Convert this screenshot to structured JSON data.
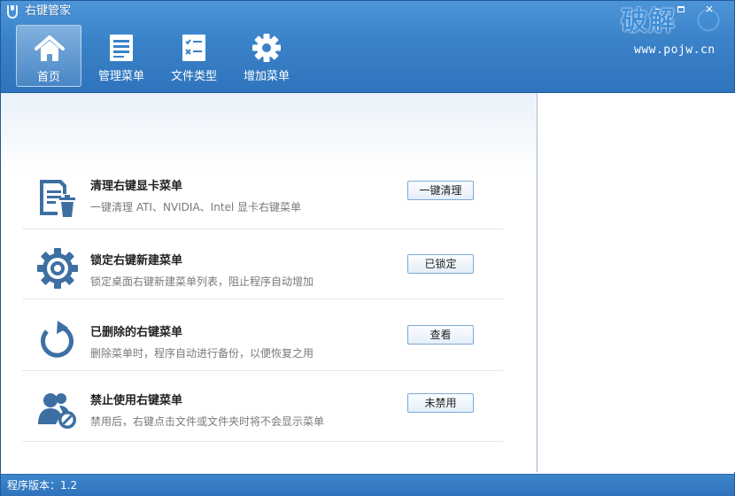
{
  "window": {
    "title": "右键管家",
    "minimize": "–",
    "close": "×"
  },
  "watermark": {
    "main": "破解",
    "url": "www.pojw.cn"
  },
  "nav": {
    "items": [
      {
        "label": "首页",
        "icon": "home-icon",
        "active": true
      },
      {
        "label": "管理菜单",
        "icon": "document-list-icon",
        "active": false
      },
      {
        "label": "文件类型",
        "icon": "checklist-icon",
        "active": false
      },
      {
        "label": "增加菜单",
        "icon": "gear-icon",
        "active": false
      }
    ]
  },
  "rows": [
    {
      "title": "清理右键显卡菜单",
      "desc": "一键清理 ATI、NVIDIA、Intel 显卡右键菜单",
      "button": "一键清理",
      "icon": "cleanup-document-icon"
    },
    {
      "title": "锁定右键新建菜单",
      "desc": "锁定桌面右键新建菜单列表，阻止程序自动增加",
      "button": "已锁定",
      "icon": "gear-lock-icon"
    },
    {
      "title": "已删除的右键菜单",
      "desc": "删除菜单时，程序自动进行备份，以便恢复之用",
      "button": "查看",
      "icon": "restore-arrow-icon"
    },
    {
      "title": "禁止使用右键菜单",
      "desc": "禁用后，右键点击文件或文件夹时将不会显示菜单",
      "button": "未禁用",
      "icon": "user-block-icon"
    }
  ],
  "status": {
    "version_text": "程序版本：1.2"
  },
  "colors": {
    "header_blue": "#3a82c8",
    "icon_blue": "#3d6fa3",
    "button_border": "#7fa9d6"
  }
}
